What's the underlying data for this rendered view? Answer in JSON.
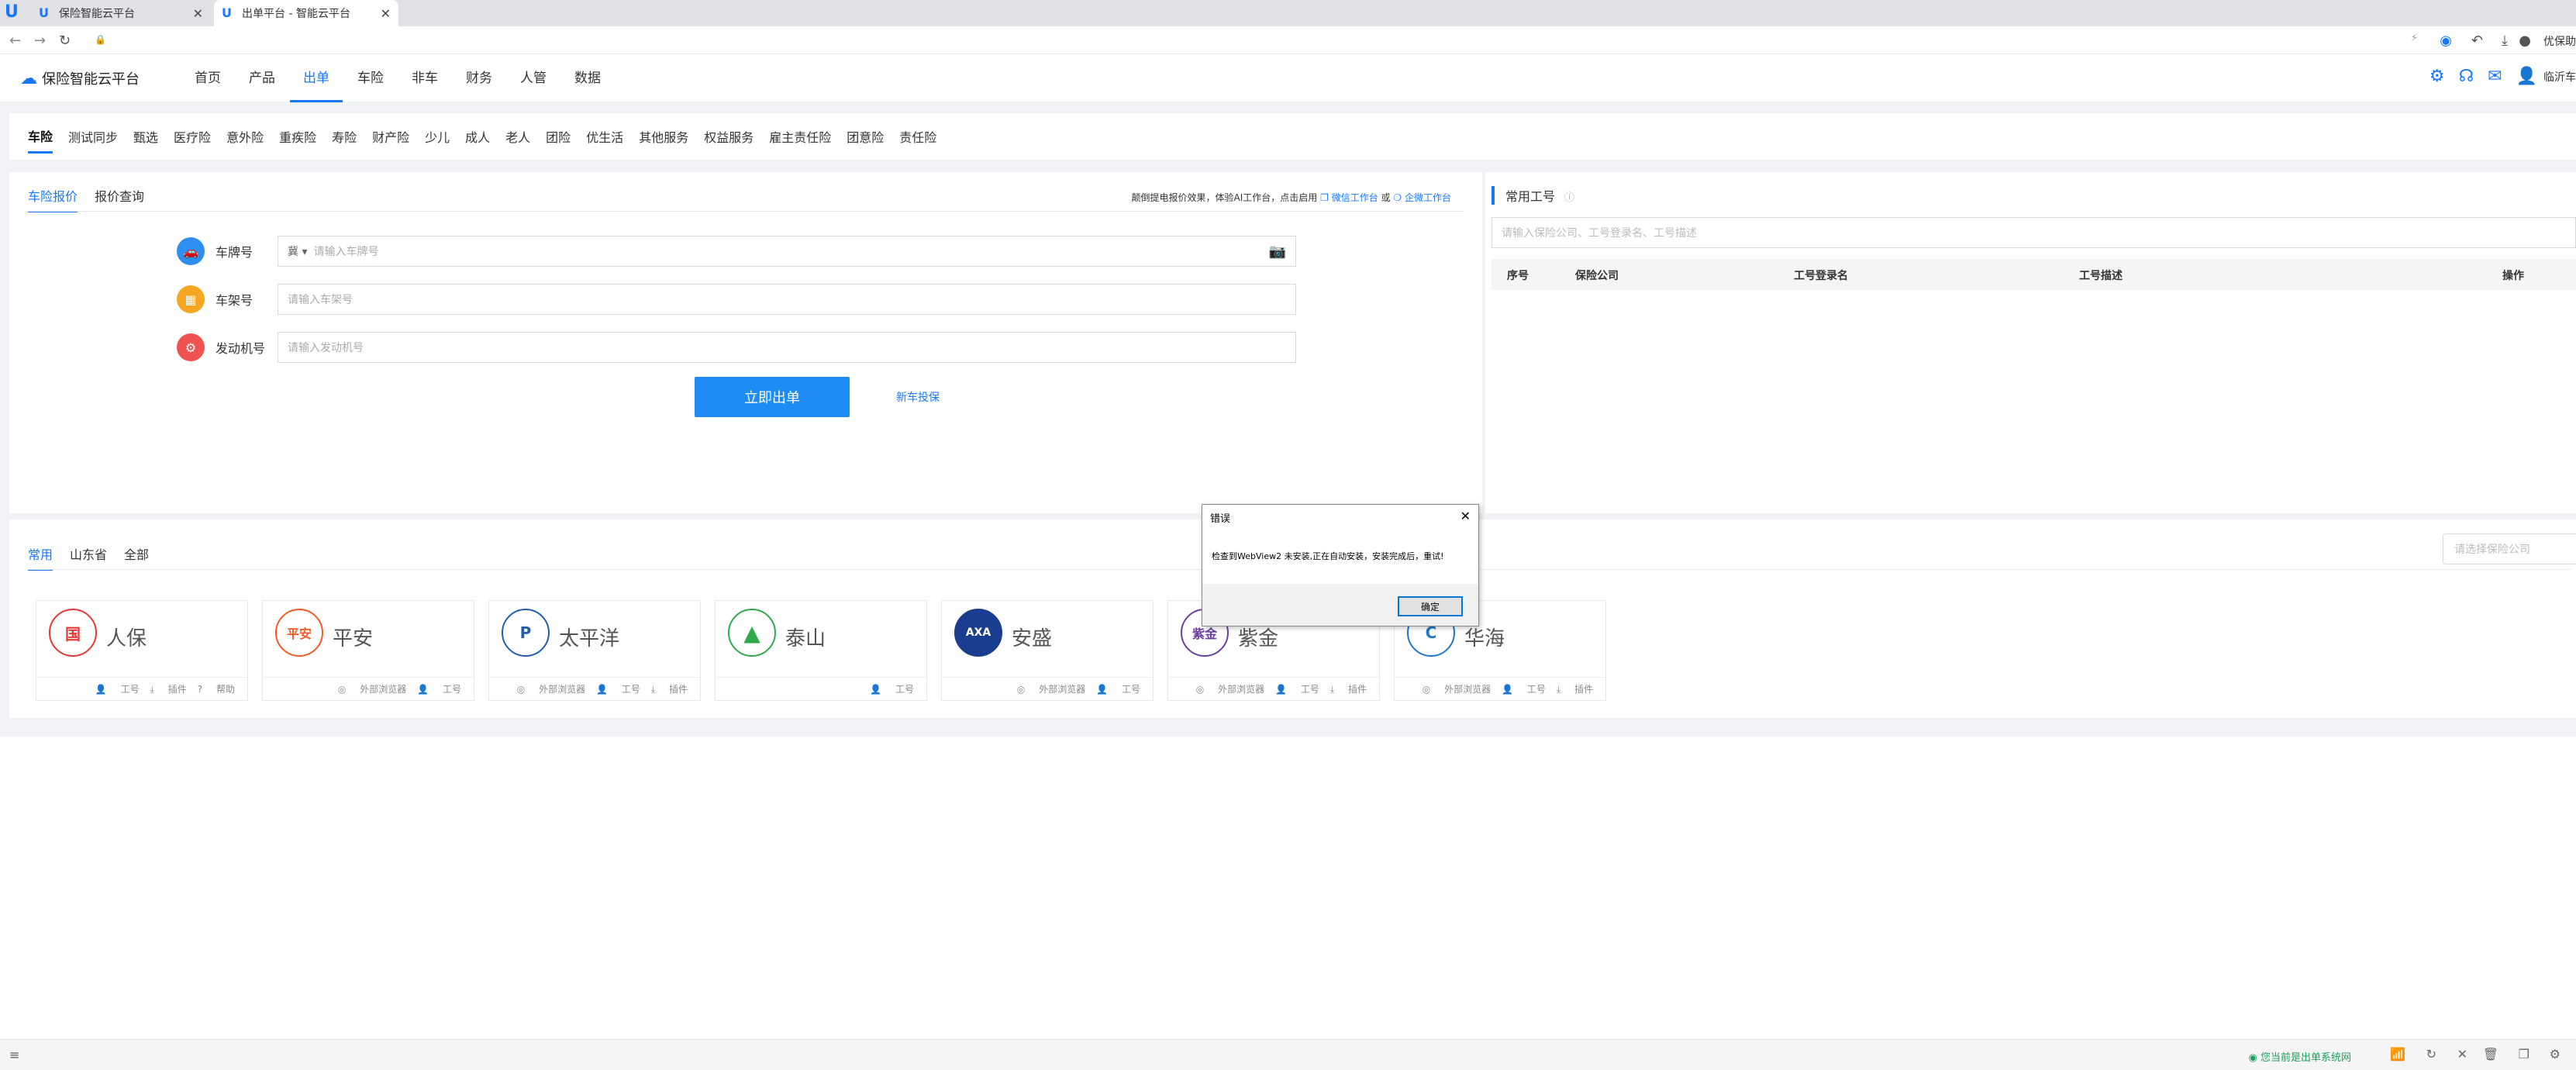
{
  "browser": {
    "tabs": [
      {
        "title": "保险智能云平台",
        "active": false
      },
      {
        "title": "出单平台 - 智能云平台",
        "active": true
      }
    ],
    "extension_label": "优保助"
  },
  "header": {
    "brand": "保险智能云平台",
    "nav": [
      "首页",
      "产品",
      "出单",
      "车险",
      "非车",
      "财务",
      "人管",
      "数据"
    ],
    "active_nav": "出单",
    "user": "临沂车"
  },
  "subnav": {
    "items": [
      "车险",
      "测试同步",
      "甄选",
      "医疗险",
      "意外险",
      "重疾险",
      "寿险",
      "财产险",
      "少儿",
      "成人",
      "老人",
      "团险",
      "优生活",
      "其他服务",
      "权益服务",
      "雇主责任险",
      "团意险",
      "责任险"
    ],
    "active": "车险"
  },
  "quote_panel": {
    "tabs": [
      "车险报价",
      "报价查询"
    ],
    "tip_prefix": "颠倒提电报价效果，体验AI工作台，点击启用",
    "tip_link1": "微信工作台",
    "tip_mid": "或",
    "tip_link2": "企微工作台",
    "fields": [
      {
        "label": "车牌号",
        "placeholder": "请输入车牌号",
        "province": "冀"
      },
      {
        "label": "车架号",
        "placeholder": "请输入车架号"
      },
      {
        "label": "发动机号",
        "placeholder": "请输入发动机号"
      }
    ],
    "submit_label": "立即出单",
    "new_car_label": "新车投保"
  },
  "common_accounts": {
    "title": "常用工号",
    "search_placeholder": "请输入保险公司、工号登录名、工号描述",
    "columns": [
      "序号",
      "保险公司",
      "工号登录名",
      "工号描述",
      "操作"
    ]
  },
  "insurers": {
    "tabs": [
      "常用",
      "山东省",
      "全部"
    ],
    "active_tab": "常用",
    "search_placeholder": "请选择保险公司",
    "cards": [
      {
        "name": "人保",
        "logo": "国",
        "color": "#e53935",
        "actions": [
          "工号",
          "插件",
          "帮助"
        ]
      },
      {
        "name": "平安",
        "logo": "平安",
        "color": "#f15a22",
        "actions": [
          "外部浏览器",
          "工号"
        ]
      },
      {
        "name": "太平洋",
        "logo": "P",
        "color": "#1f5fae",
        "actions": [
          "外部浏览器",
          "工号",
          "插件"
        ]
      },
      {
        "name": "泰山",
        "logo": "▲",
        "color": "#2eaa4a",
        "actions": [
          "工号"
        ]
      },
      {
        "name": "安盛",
        "logo": "AXA",
        "color": "#1a3d8f",
        "actions": [
          "外部浏览器",
          "工号"
        ]
      },
      {
        "name": "紫金",
        "logo": "紫金",
        "color": "#6b3fa0",
        "actions": [
          "外部浏览器",
          "工号",
          "插件"
        ]
      },
      {
        "name": "华海",
        "logo": "C",
        "color": "#1e78c8",
        "actions": [
          "外部浏览器",
          "工号",
          "插件"
        ]
      }
    ]
  },
  "dialog": {
    "title": "错误",
    "message": "检查到WebView2 未安装,正在自动安装，安装完成后，重试!",
    "ok_label": "确定"
  },
  "statusbar": {
    "message": "您当前是出单系统网"
  }
}
